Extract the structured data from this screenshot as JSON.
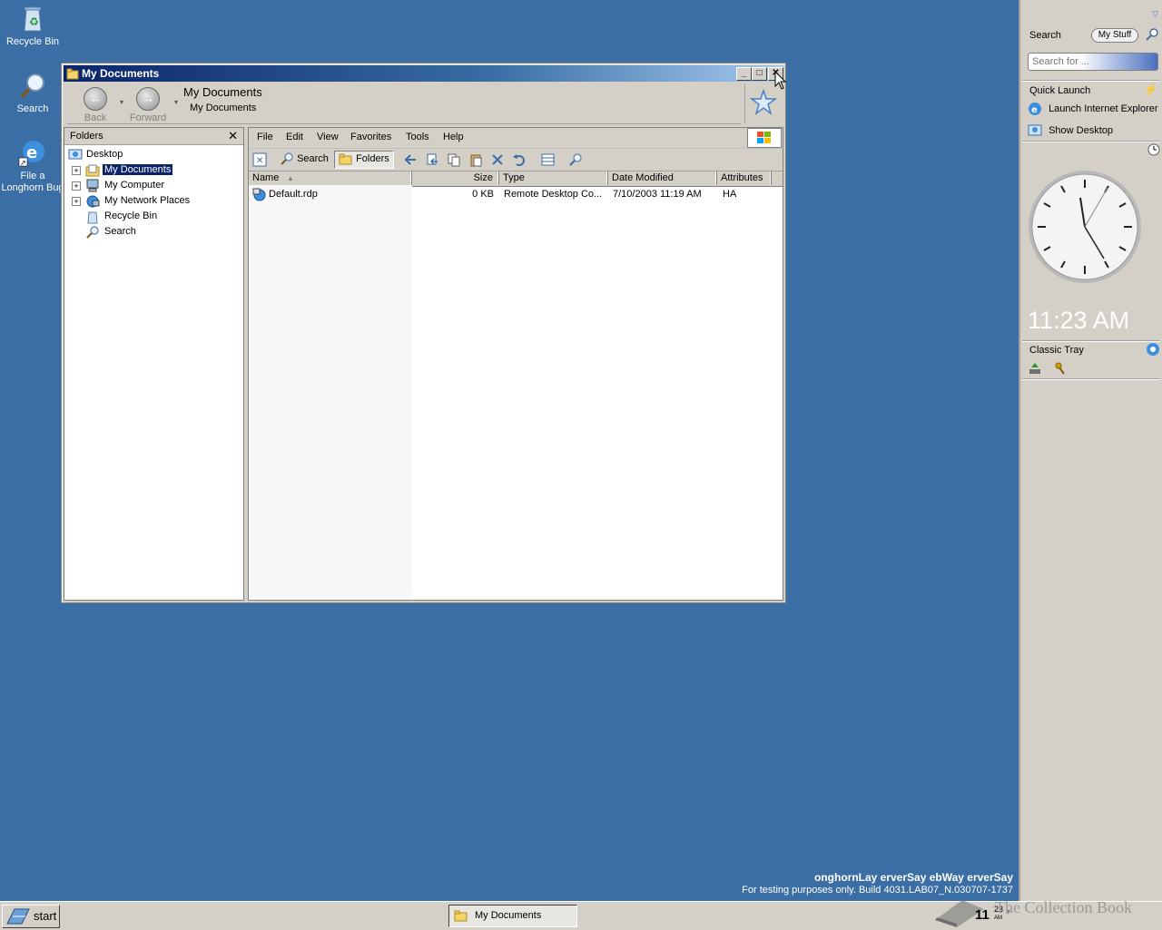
{
  "desktop": {
    "icons": [
      {
        "label": "Recycle Bin"
      },
      {
        "label": "Search"
      },
      {
        "label": "File a Longhorn Bug"
      }
    ],
    "watermark_line1": "onghornLay erverSay ebWay erverSay",
    "watermark_line2": "For testing purposes only. Build 4031.LAB07_N.030707-1737"
  },
  "window": {
    "title": "My Documents",
    "nav": {
      "back_label": "Back",
      "forward_label": "Forward",
      "address_title": "My Documents",
      "address_path": "My Documents"
    },
    "folders_pane": {
      "title": "Folders",
      "items": [
        {
          "label": "Desktop"
        },
        {
          "label": "My Documents",
          "selected": true
        },
        {
          "label": "My Computer"
        },
        {
          "label": "My Network Places"
        },
        {
          "label": "Recycle Bin"
        },
        {
          "label": "Search"
        }
      ]
    },
    "menu": [
      "File",
      "Edit",
      "View",
      "Favorites",
      "Tools",
      "Help"
    ],
    "toolbar": {
      "search_label": "Search",
      "folders_label": "Folders"
    },
    "columns": [
      "Name",
      "Size",
      "Type",
      "Date Modified",
      "Attributes"
    ],
    "files": [
      {
        "name": "Default.rdp",
        "size": "0 KB",
        "type": "Remote Desktop Co...",
        "date": "7/10/2003 11:19 AM",
        "attributes": "HA"
      }
    ]
  },
  "sidebar": {
    "search_title": "Search",
    "mystuff_label": "My Stuff",
    "search_placeholder": "Search for ...",
    "quick_launch_title": "Quick Launch",
    "quick_launch_items": [
      "Launch Internet Explorer",
      "Show Desktop"
    ],
    "clock_time": "11:23 AM",
    "classic_tray_title": "Classic Tray"
  },
  "taskbar": {
    "start_label": "start",
    "task_label": "My Documents",
    "tray_hour": "11",
    "tray_min": "23",
    "tray_ampm": "AM",
    "collection_book": "The Collection Book"
  },
  "colors": {
    "desktop": "#3b6ea5",
    "chrome": "#d4d0c8",
    "title_start": "#0a246a",
    "selection": "#0a246a"
  }
}
